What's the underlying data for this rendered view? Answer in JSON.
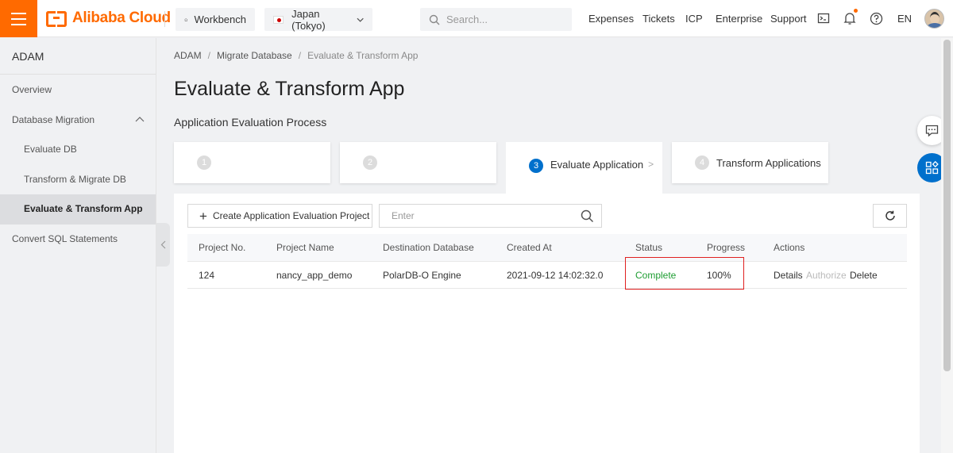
{
  "brand": {
    "name": "Alibaba Cloud",
    "accent": "#ff6a00"
  },
  "topbar": {
    "workbench": "Workbench",
    "region": "Japan (Tokyo)",
    "search_placeholder": "Search...",
    "nav": [
      "Expenses",
      "Tickets",
      "ICP",
      "Enterprise",
      "Support"
    ],
    "language": "EN",
    "icons": [
      "terminal-icon",
      "bell-icon",
      "help-icon"
    ]
  },
  "sidebar": {
    "title": "ADAM",
    "items": [
      {
        "label": "Overview"
      },
      {
        "label": "Database Migration"
      },
      {
        "label": "Evaluate DB"
      },
      {
        "label": "Transform & Migrate DB"
      },
      {
        "label": "Evaluate & Transform App"
      },
      {
        "label": "Convert SQL Statements"
      }
    ]
  },
  "breadcrumb": [
    "ADAM",
    "Migrate Database",
    "Evaluate & Transform App"
  ],
  "page": {
    "title": "Evaluate & Transform App",
    "subtitle": "Application Evaluation Process"
  },
  "steps": [
    {
      "num": "1",
      "label": ""
    },
    {
      "num": "2",
      "label": ""
    },
    {
      "num": "3",
      "label": "Evaluate Application",
      "arrow": ">"
    },
    {
      "num": "4",
      "label": "Transform Applications"
    }
  ],
  "toolbar": {
    "create_label": "Create Application Evaluation Project",
    "filter_placeholder": "Enter"
  },
  "table": {
    "columns": [
      "Project No.",
      "Project Name",
      "Destination Database",
      "Created At",
      "Status",
      "Progress",
      "Actions"
    ],
    "rows": [
      {
        "project_no": "124",
        "project_name": "nancy_app_demo",
        "destination": "PolarDB-O Engine",
        "created_at": "2021-09-12 14:02:32.0",
        "status": "Complete",
        "progress": "100%",
        "actions": [
          "Details",
          "Authorize",
          "Delete"
        ]
      }
    ]
  },
  "colors": {
    "primary": "#0070cc",
    "success": "#1e9d32",
    "highlight": "#e02020"
  }
}
